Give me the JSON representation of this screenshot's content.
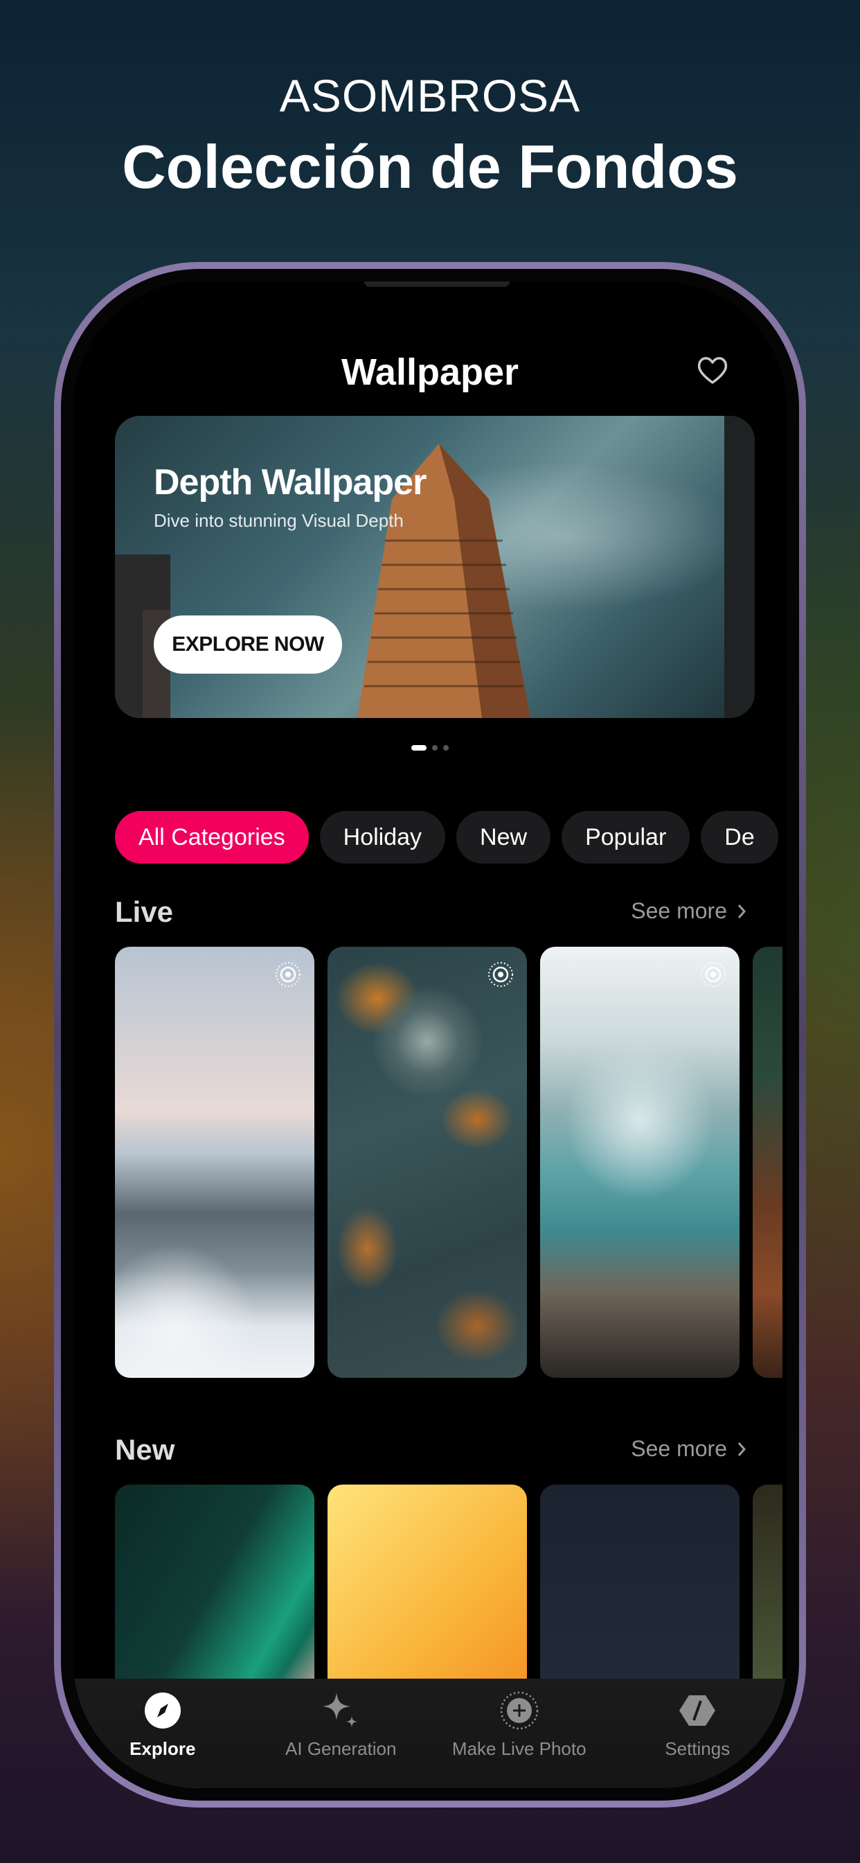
{
  "hero": {
    "subtitle": "ASOMBROSA",
    "title": "Colección de Fondos"
  },
  "app": {
    "title": "Wallpaper",
    "favorite_icon": "heart-icon"
  },
  "banner": {
    "title": "Depth Wallpaper",
    "subtitle": "Dive into stunning Visual Depth",
    "button_label": "EXPLORE NOW",
    "pagination": {
      "total": 3,
      "current": 1
    }
  },
  "categories": [
    {
      "label": "All Categories",
      "active": true
    },
    {
      "label": "Holiday",
      "active": false
    },
    {
      "label": "New",
      "active": false
    },
    {
      "label": "Popular",
      "active": false
    },
    {
      "label": "De",
      "active": false
    }
  ],
  "sections": {
    "live": {
      "title": "Live",
      "see_more": "See more"
    },
    "new": {
      "title": "New",
      "see_more": "See more"
    }
  },
  "tabbar": [
    {
      "label": "Explore",
      "icon": "compass-icon",
      "active": true
    },
    {
      "label": "AI Generation",
      "icon": "sparkles-icon",
      "active": false
    },
    {
      "label": "Make Live Photo",
      "icon": "live-plus-icon",
      "active": false
    },
    {
      "label": "Settings",
      "icon": "hexagon-icon",
      "active": false
    }
  ],
  "colors": {
    "accent": "#f2005e",
    "chip_bg": "#1c1c1e",
    "screen_bg": "#000000"
  }
}
